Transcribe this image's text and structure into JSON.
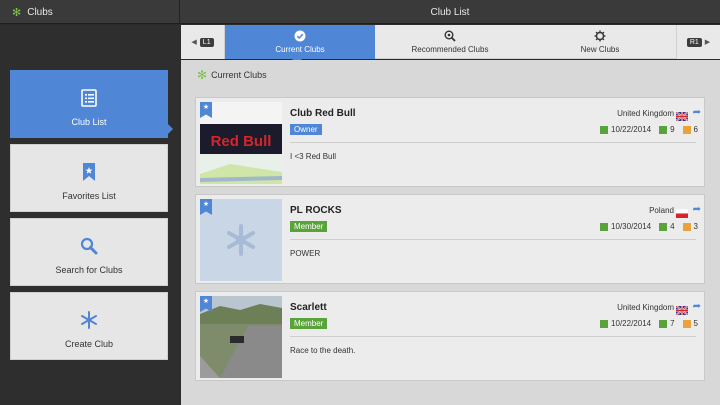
{
  "app": {
    "section": "Clubs",
    "title": "Club List"
  },
  "sidebar": {
    "items": [
      {
        "label": "Club List",
        "icon": "list-icon",
        "active": true
      },
      {
        "label": "Favorites List",
        "icon": "bookmark-icon"
      },
      {
        "label": "Search for Clubs",
        "icon": "magnifier-icon"
      },
      {
        "label": "Create Club",
        "icon": "snowflake-icon"
      }
    ]
  },
  "tabs": {
    "left_shoulder": "L1",
    "right_shoulder": "R1",
    "items": [
      {
        "label": "Current Clubs",
        "icon": "checkmark-icon",
        "active": true
      },
      {
        "label": "Recommended Clubs",
        "icon": "search-plus-icon"
      },
      {
        "label": "New Clubs",
        "icon": "gear-icon"
      }
    ]
  },
  "section_header": "Current Clubs",
  "clubs": [
    {
      "name": "Club Red Bull",
      "role": "Owner",
      "description": "I <3 Red Bull",
      "country": "United Kingdom",
      "date": "10/22/2014",
      "count_a": "9",
      "count_b": "6",
      "thumb_text": "Red Bull"
    },
    {
      "name": "PL ROCKS",
      "role": "Member",
      "description": "POWER",
      "country": "Poland",
      "date": "10/30/2014",
      "count_a": "4",
      "count_b": "3"
    },
    {
      "name": "Scarlett",
      "role": "Member",
      "description": "Race to the death.",
      "country": "United Kingdom",
      "date": "10/22/2014",
      "count_a": "7",
      "count_b": "5"
    }
  ],
  "colors": {
    "accent": "#4f86d6",
    "member": "#5aa33a",
    "star": "#7fc34a"
  }
}
